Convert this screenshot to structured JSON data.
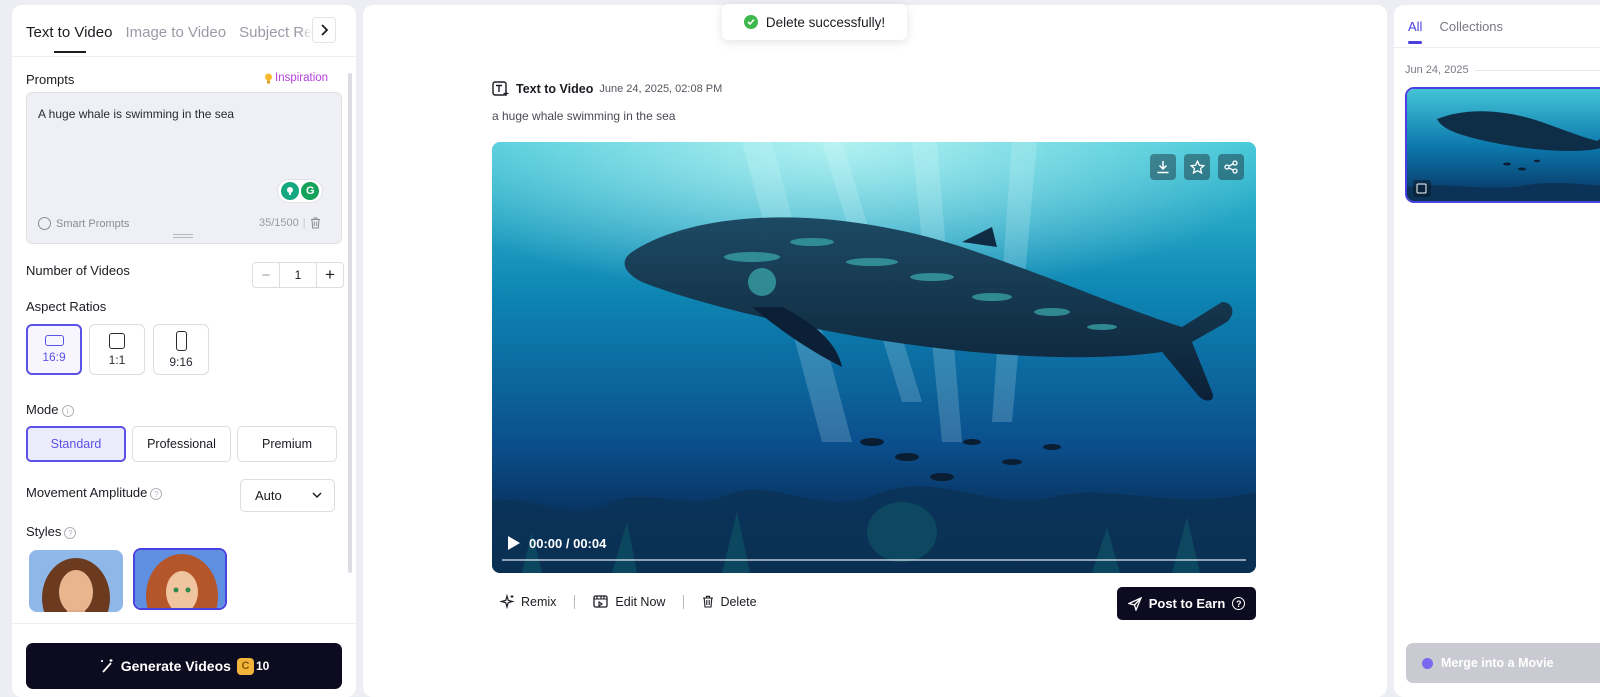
{
  "left_panel": {
    "tabs": [
      "Text to Video",
      "Image to Video",
      "Subject Re"
    ],
    "prompts_label": "Prompts",
    "inspiration_label": "Inspiration",
    "prompt_text": "A huge whale is swimming in the sea",
    "smart_prompts_label": "Smart Prompts",
    "char_count": "35/1500",
    "number_of_videos_label": "Number of Videos",
    "number_of_videos_value": "1",
    "aspect_ratios_label": "Aspect Ratios",
    "aspect_ratios": [
      "16:9",
      "1:1",
      "9:16"
    ],
    "selected_aspect_ratio": "16:9",
    "mode_label": "Mode",
    "modes": [
      "Standard",
      "Professional",
      "Premium"
    ],
    "selected_mode": "Standard",
    "movement_label": "Movement Amplitude",
    "movement_value": "Auto",
    "styles_label": "Styles",
    "generate_label": "Generate Videos",
    "generate_cost": "10"
  },
  "toast": {
    "message": "Delete successfully!"
  },
  "center_panel": {
    "type_label": "Text to Video",
    "date": "June 24, 2025, 02:08 PM",
    "prompt": "a huge whale swimming in the sea",
    "video_time": "00:00 / 00:04",
    "progress": 0,
    "actions": [
      "Remix",
      "Edit Now",
      "Delete"
    ],
    "post_label": "Post to Earn"
  },
  "right_panel": {
    "tabs": [
      "All",
      "Collections"
    ],
    "date_group": "Jun 24, 2025",
    "merge_label": "Merge into a Movie"
  },
  "colors": {
    "accent": "#4a40e0",
    "dark": "#0d0b1f",
    "success": "#3db84b",
    "inspiration": "#b540d9"
  }
}
